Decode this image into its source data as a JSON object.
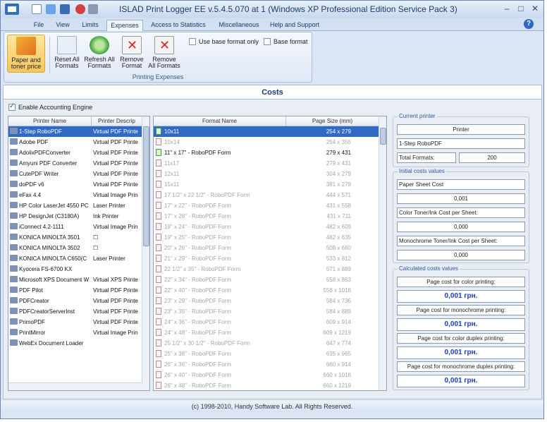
{
  "window": {
    "title": "ISLAD Print Logger EE v.5.4.5.070 at 1 (Windows XP Professional Edition Service Pack 3)",
    "min": "–",
    "max": "□",
    "close": "✕"
  },
  "menu": {
    "tabs": [
      "File",
      "View",
      "Limits",
      "Expenses",
      "Access to Statistics",
      "Miscellaneous",
      "Help and Support"
    ],
    "active": "Expenses",
    "help": "?"
  },
  "ribbon": {
    "buttons": [
      {
        "label1": "Paper and",
        "label2": "toner price",
        "icon": "paper-price-icon"
      },
      {
        "label1": "Reset All",
        "label2": "Formats",
        "icon": "reset-icon"
      },
      {
        "label1": "Refresh All",
        "label2": "Formats",
        "icon": "refresh-icon"
      },
      {
        "label1": "Remove",
        "label2": "Format",
        "icon": "remove-icon"
      },
      {
        "label1": "Remove",
        "label2": "All Formats",
        "icon": "remove-all-icon"
      }
    ],
    "use_base_format": "Use base format only",
    "base_format": "Base format",
    "group_label": "Printing Expenses"
  },
  "costs": {
    "header": "Costs",
    "enable_accounting": "Enable Accounting Engine"
  },
  "printers": {
    "columns": [
      "Printer Name",
      "Printer Descrip"
    ],
    "rows": [
      [
        "1-Step RoboPDF",
        "Virtual PDF Printe"
      ],
      [
        "Adobe PDF",
        "Virtual PDF Printe"
      ],
      [
        "AdolixPDFConverter",
        "Virtual PDF Printe"
      ],
      [
        "Amyuni PDF Converter",
        "Virtual PDF Printe"
      ],
      [
        "CutePDF Writer",
        "Virtual PDF Printe"
      ],
      [
        "doPDF v6",
        "Virtual PDF Printe"
      ],
      [
        "eFax 4.4",
        "Virtual Image Prin"
      ],
      [
        "HP Color LaserJet 4550 PC",
        "Laser Printer"
      ],
      [
        "HP DesignJet (C3180A)",
        "Ink Printer"
      ],
      [
        "iConnect 4.2-1111",
        "Virtual Image Prin"
      ],
      [
        "KONICA MINOLTA 3501",
        "☐"
      ],
      [
        "KONICA MINOLTA 3502",
        "☐"
      ],
      [
        "KONICA MINOLTA C650(C",
        "Laser Printer"
      ],
      [
        "Kyocera FS-6700 KX",
        ""
      ],
      [
        "Microsoft XPS Document W",
        "Virtual XPS Printe"
      ],
      [
        "PDF Pilot",
        "Virtual PDF Printe"
      ],
      [
        "PDFCreator",
        "Virtual PDF Printe"
      ],
      [
        "PDFCreatorServerInst",
        "Virtual PDF Printe"
      ],
      [
        "PrimoPDF",
        "Virtual PDF Printe"
      ],
      [
        "PrintMirror",
        "Virtual Image Prin"
      ],
      [
        "WebEx Document Loader",
        ""
      ]
    ],
    "selected": 0
  },
  "formats": {
    "columns": [
      "Format Name",
      "Page Size (mm)"
    ],
    "rows": [
      [
        "10x11",
        "254 x 279",
        "ok"
      ],
      [
        "10x14",
        "254 x 355",
        "dim"
      ],
      [
        "11\" x 17\" - RoboPDF Form",
        "279 x 431",
        "ok"
      ],
      [
        "11x17",
        "279 x 431",
        "dim"
      ],
      [
        "12x11",
        "304 x 279",
        "dim"
      ],
      [
        "15x11",
        "381 x 279",
        "dim"
      ],
      [
        "17 1/2\" x 22 1/2\" - RoboPDF Form",
        "444 x 571",
        "dim"
      ],
      [
        "17\" x 22\" - RoboPDF Form",
        "431 x 558",
        "dim"
      ],
      [
        "17\" x 28\" - RoboPDF Form",
        "431 x 711",
        "dim"
      ],
      [
        "19\" x 24\" - RoboPDF Form",
        "482 x 609",
        "dim"
      ],
      [
        "19\" x 25\" - RoboPDF Form",
        "482 x 635",
        "dim"
      ],
      [
        "20\" x 26\" - RoboPDF Form",
        "508 x 660",
        "dim"
      ],
      [
        "21\" x 29\" - RoboPDF Form",
        "533 x 812",
        "dim"
      ],
      [
        "22 1/2\" x 35\" - RoboPDF Form",
        "571 x 889",
        "dim"
      ],
      [
        "22\" x 34\" - RoboPDF Form",
        "558 x 863",
        "dim"
      ],
      [
        "22\" x 40\" - RoboPDF Form",
        "558 x 1016",
        "dim"
      ],
      [
        "23\" x 29\" - RoboPDF Form",
        "584 x 736",
        "dim"
      ],
      [
        "23\" x 35\" - RoboPDF Form",
        "584 x 889",
        "dim"
      ],
      [
        "24\" x 36\" - RoboPDF Form",
        "609 x 914",
        "dim"
      ],
      [
        "24\" x 48\" - RoboPDF Form",
        "609 x 1219",
        "dim"
      ],
      [
        "25 1/2\" x 30 1/2\" - RoboPDF Form",
        "647 x 774",
        "dim"
      ],
      [
        "25\" x 38\" - RoboPDF Form",
        "635 x 965",
        "dim"
      ],
      [
        "26\" x 36\" - RoboPDF Form",
        "660 x 914",
        "dim"
      ],
      [
        "26\" x 40\" - RoboPDF Form",
        "660 x 1016",
        "dim"
      ],
      [
        "26\" x 48\" - RoboPDF Form",
        "660 x 1219",
        "dim"
      ]
    ],
    "selected": 0
  },
  "current_printer": {
    "title": "Current printer",
    "printer_label": "Printer",
    "printer_name": "1-Step RoboPDF",
    "total_formats_label": "Total Formats:",
    "total_formats": "200"
  },
  "initial_costs": {
    "title": "Initial costs values",
    "paper_label": "Paper Sheet Cost",
    "paper_value": "0,001",
    "color_label": "Color Toner/Ink Cost per Sheet:",
    "color_value": "0,000",
    "mono_label": "Monochrome Toner/Ink Cost per Sheet:",
    "mono_value": "0,000"
  },
  "calculated_costs": {
    "title": "Calculated costs values",
    "items": [
      {
        "label": "Page cost for color printing:",
        "value": "0,001 грн."
      },
      {
        "label": "Page cost for monochrome printing:",
        "value": "0,001 грн."
      },
      {
        "label": "Page cost for color duplex printing:",
        "value": "0,001 грн."
      },
      {
        "label": "Page cost for monochrome duplex printing:",
        "value": "0,001 грн."
      }
    ]
  },
  "footer": "(c) 1998-2010, Handy Software Lab. All Rights Reserved."
}
